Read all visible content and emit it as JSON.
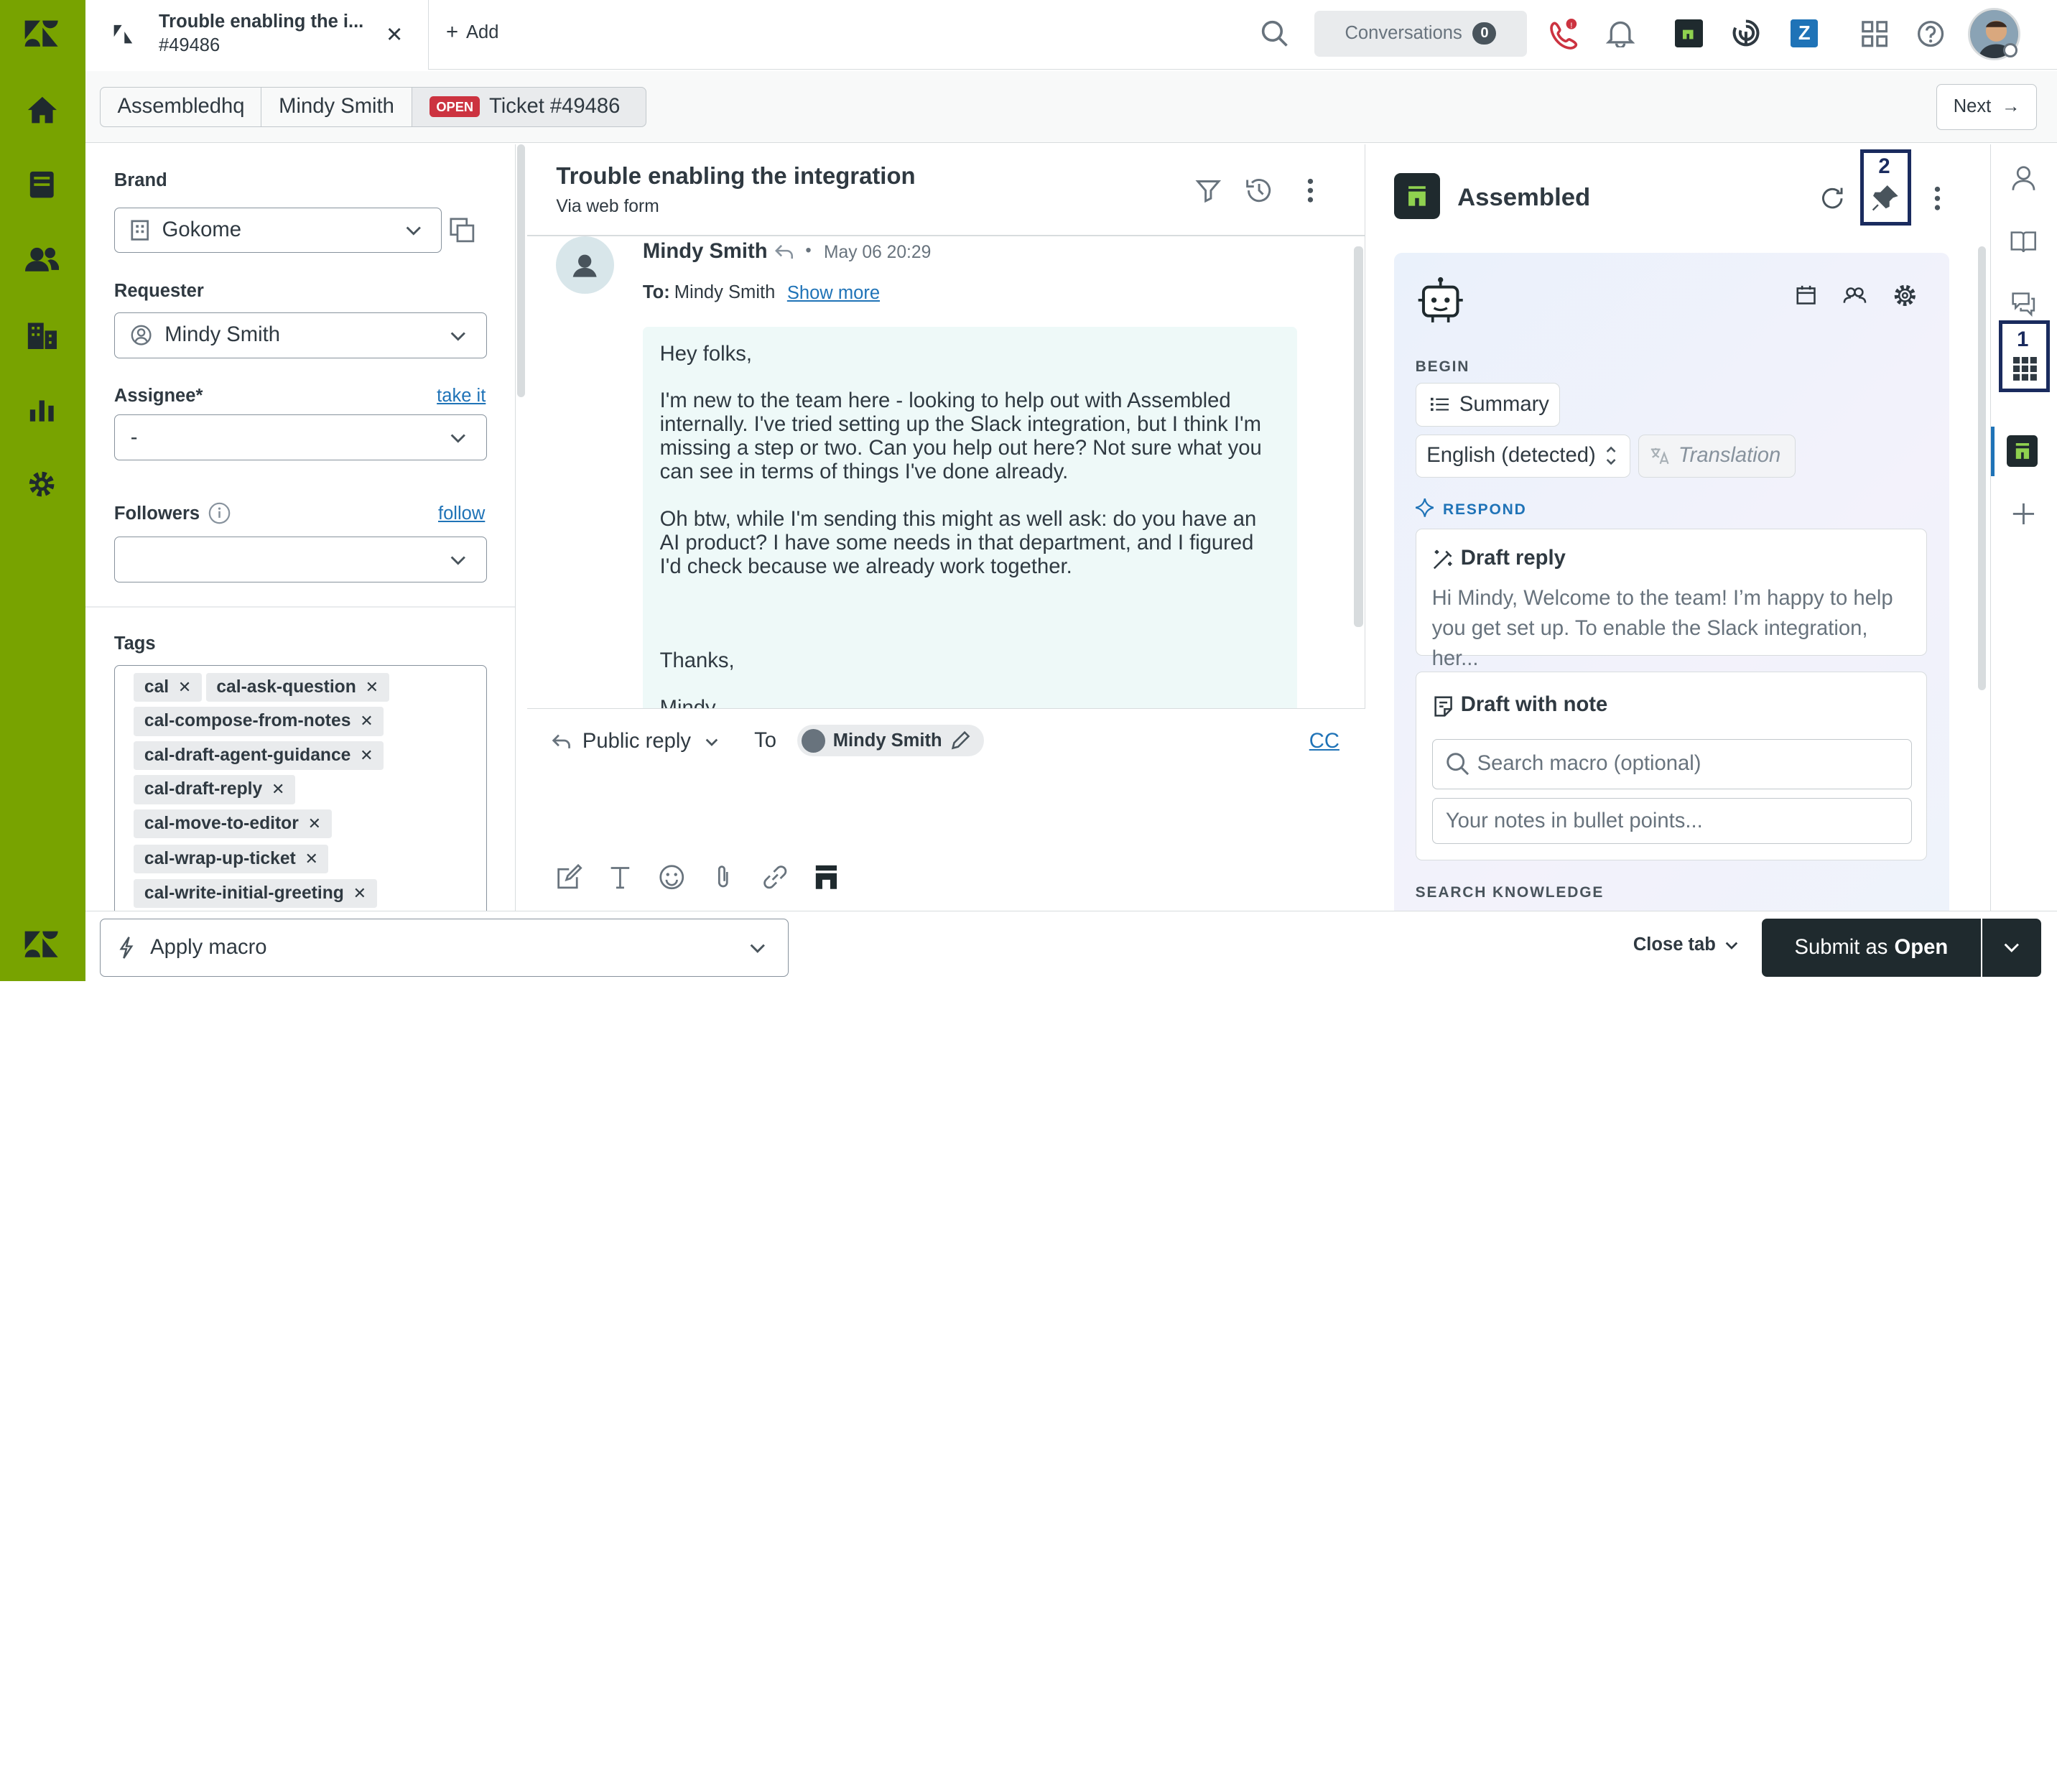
{
  "tab": {
    "title": "Trouble enabling the i...",
    "number": "#49486"
  },
  "topbar": {
    "add_label": "Add",
    "conversations_label": "Conversations",
    "conversations_count": "0"
  },
  "breadcrumb": {
    "org": "Assembledhq",
    "requester": "Mindy Smith",
    "status": "OPEN",
    "ticket": "Ticket #49486",
    "next_label": "Next"
  },
  "left": {
    "brand_label": "Brand",
    "brand_value": "Gokome",
    "requester_label": "Requester",
    "requester_value": "Mindy Smith",
    "assignee_label": "Assignee*",
    "assignee_link": "take it",
    "assignee_value": "-",
    "followers_label": "Followers",
    "followers_link": "follow",
    "tags_label": "Tags",
    "tags": [
      "cal",
      "cal-ask-question",
      "cal-compose-from-notes",
      "cal-draft-agent-guidance",
      "cal-draft-reply",
      "cal-move-to-editor",
      "cal-wrap-up-ticket",
      "cal-write-initial-greeting"
    ]
  },
  "ticket": {
    "subject": "Trouble enabling the integration",
    "via": "Via web form",
    "author": "Mindy Smith",
    "date": "May 06 20:29",
    "to_label": "To:",
    "to_value": "Mindy Smith",
    "show_more": "Show more",
    "body": [
      "Hey folks,",
      "I'm new to the team here - looking to help out with Assembled internally. I've tried setting up the Slack integration, but I think I'm missing a step or two. Can you help out here? Not sure what you can see in terms of things I've done already.",
      "Oh btw, while I'm sending this might as well ask: do you have an AI product? I have some needs in that department, and I figured I'd check because we already work together.",
      "Thanks,",
      "Mindy"
    ]
  },
  "reply": {
    "mode": "Public reply",
    "to_label": "To",
    "recipient": "Mindy Smith",
    "cc": "CC"
  },
  "app": {
    "title": "Assembled",
    "annotation_pin": "2",
    "begin": "BEGIN",
    "summary": "Summary",
    "language": "English (detected)",
    "translation": "Translation",
    "respond": "RESPOND",
    "draft_reply_title": "Draft reply",
    "draft_reply_text": "Hi Mindy, Welcome to the team! I’m happy to help you get set up. To enable the Slack integration, her...",
    "draft_note_title": "Draft with note",
    "macro_placeholder": "Search macro (optional)",
    "notes_placeholder": "Your notes in bullet points...",
    "search_knowledge": "SEARCH KNOWLEDGE"
  },
  "rail": {
    "annotation_apps": "1"
  },
  "footer": {
    "macro": "Apply macro",
    "close_tab": "Close tab",
    "submit_prefix": "Submit as",
    "submit_status": "Open"
  },
  "colors": {
    "nav_green": "#78a300",
    "submit": "#1f2a2e",
    "open_badge": "#cc3340",
    "link": "#1f73b7",
    "annotation": "#1a2b5e"
  }
}
